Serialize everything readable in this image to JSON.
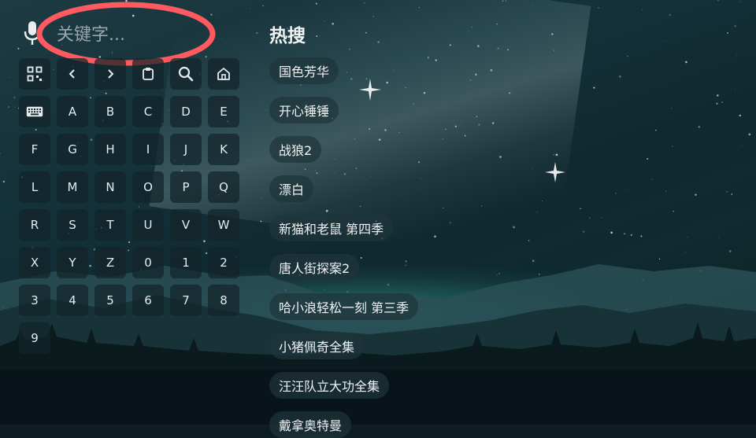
{
  "search": {
    "placeholder": "关键字..."
  },
  "keyboard": {
    "function_keys": [
      {
        "icon": "qr-code-icon",
        "name": "qr-code-key"
      },
      {
        "icon": "chevron-left-icon",
        "name": "back-key"
      },
      {
        "icon": "chevron-right-icon",
        "name": "forward-key"
      },
      {
        "icon": "clipboard-icon",
        "name": "paste-key"
      },
      {
        "icon": "search-icon",
        "name": "search-key"
      },
      {
        "icon": "home-icon",
        "name": "home-key"
      }
    ],
    "keys": [
      "A",
      "B",
      "C",
      "D",
      "E",
      "F",
      "G",
      "H",
      "I",
      "J",
      "K",
      "L",
      "M",
      "N",
      "O",
      "P",
      "Q",
      "R",
      "S",
      "T",
      "U",
      "V",
      "W",
      "X",
      "Y",
      "Z",
      "0",
      "1",
      "2",
      "3",
      "4",
      "5",
      "6",
      "7",
      "8",
      "9"
    ]
  },
  "hot": {
    "title": "热搜",
    "items": [
      "国色芳华",
      "开心锤锤",
      "战狼2",
      "漂白",
      "新猫和老鼠 第四季",
      "唐人街探案2",
      "哈小浪轻松一刻 第三季",
      "小猪佩奇全集",
      "汪汪队立大功全集",
      "戴拿奥特曼"
    ]
  },
  "colors": {
    "annotation": "#ff5a5f",
    "key_bg": "#12242a",
    "chip_bg": "#1e343a"
  }
}
